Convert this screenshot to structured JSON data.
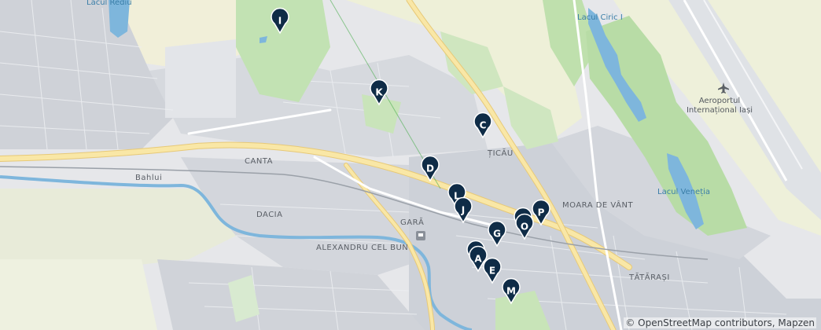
{
  "map": {
    "labels": {
      "lacul_rediu": "Lacul Rediu",
      "lacul_ciric": "Lacul Ciric I",
      "aeroport": "Aeroportul",
      "aeroport_line2": "Internațional Iași",
      "ticau": "ȚICĂU",
      "canta": "CANTA",
      "bahlui": "Bahlui",
      "dacia": "DACIA",
      "gara": "GARĂ",
      "alexandru": "ALEXANDRU CEL BUN",
      "moara": "MOARA DE VÂNT",
      "lacul_venetia": "Lacul Veneția",
      "tatarasi": "TĂTĂRAȘI"
    },
    "markers": [
      "I",
      "K",
      "C",
      "D",
      "L",
      "J",
      "G",
      "N",
      "O",
      "P",
      "F",
      "A",
      "E",
      "M"
    ],
    "colors": {
      "marker": "#0f2c47",
      "water": "#7eb6dc",
      "park": "#bfe0b0",
      "road": "#f7e3a0",
      "urban": "#cfd3da"
    }
  },
  "attribution": "© OpenStreetMap contributors, Mapzen"
}
